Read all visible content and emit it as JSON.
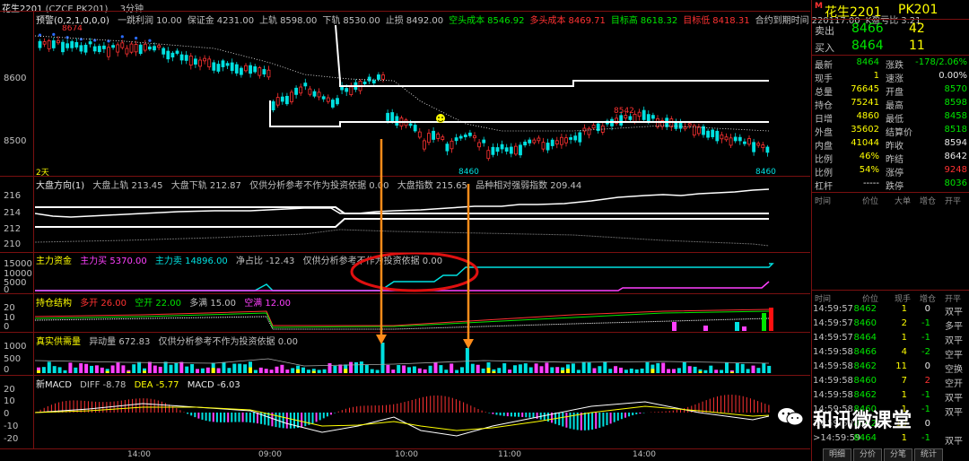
{
  "top_bar": {
    "symbol_label": "花生2201",
    "code_label": "(CZCE PK201)",
    "period_label": "3分钟"
  },
  "main_panel": {
    "indicator_name": "预警(0,2,1,0,0,0)",
    "stats": [
      {
        "label": "一跳利润",
        "value": "10.00",
        "color": "#c0c0c0"
      },
      {
        "label": "保证金",
        "value": "4231.00",
        "color": "#c0c0c0"
      },
      {
        "label": "上轨",
        "value": "8598.00",
        "color": "#c0c0c0"
      },
      {
        "label": "下轨",
        "value": "8530.00",
        "color": "#c0c0c0"
      },
      {
        "label": "止损",
        "value": "8492.00",
        "color": "#c0c0c0"
      },
      {
        "label": "空头成本",
        "value": "8546.92",
        "color": "#00e600"
      },
      {
        "label": "多头成本",
        "value": "8469.71",
        "color": "#ff3232"
      },
      {
        "label": "目标高",
        "value": "8618.32",
        "color": "#00e600"
      },
      {
        "label": "目标低",
        "value": "8418.31",
        "color": "#ff3232"
      },
      {
        "label": "合约到期时间",
        "value": "220117.00",
        "color": "#c0c0c0"
      },
      {
        "label": "K盈亏比",
        "value": "3.21",
        "color": "#c0c0c0"
      }
    ],
    "y_labels": [
      "8600",
      "8500"
    ],
    "high_mark": "8674",
    "mid_mark": "8542",
    "low_mark_1": "8460",
    "low_mark_2": "8460",
    "days_label": "2天"
  },
  "market_panel": {
    "title": "大盘方向(1)",
    "items": [
      "大盘上轨 213.45",
      "大盘下轨 212.87",
      "仅供分析参考不作为投资依据 0.00",
      "大盘指数 215.65",
      "品种相对强弱指数 209.44"
    ],
    "y_labels": [
      "216",
      "214",
      "212",
      "210"
    ]
  },
  "capital_panel": {
    "title": "主力资金",
    "buy_label": "主力买 5370.00",
    "sell_label": "主力卖 14896.00",
    "net_label": "净占比 -12.43",
    "note": "仅供分析参考不作为投资依据 0.00",
    "y_labels": [
      "15000",
      "10000",
      "5000",
      "0"
    ]
  },
  "position_panel": {
    "title": "持仓结构",
    "items": [
      {
        "text": "多开 26.00",
        "color": "#ff3232"
      },
      {
        "text": "空开 22.00",
        "color": "#00e600"
      },
      {
        "text": "多满 15.00",
        "color": "#c0c0c0"
      },
      {
        "text": "空满 12.00",
        "color": "#ff40ff"
      }
    ],
    "y_labels": [
      "20",
      "10",
      "0"
    ]
  },
  "volume_panel": {
    "title": "真实供需量",
    "abnormal_label": "异动量 672.83",
    "note": "仅供分析参考不作为投资依据 0.00",
    "y_labels": [
      "1000",
      "500",
      "0"
    ]
  },
  "macd_panel": {
    "title": "新MACD",
    "diff": "DIFF -8.78",
    "dea": "DEA -5.77",
    "macd": "MACD -6.03",
    "y_labels": [
      "20",
      "10",
      "0",
      "-10",
      "-20"
    ]
  },
  "time_axis": [
    "14:00",
    "09:00",
    "10:00",
    "11:00",
    "14:00"
  ],
  "quote": {
    "m_badge": "M",
    "name": "花生2201",
    "code": "PK201",
    "sell_label": "卖出",
    "sell_price": "8466",
    "sell_vol": "42",
    "buy_label": "买入",
    "buy_price": "8464",
    "buy_vol": "11",
    "rows": [
      {
        "l1": "最新",
        "v1": "8464",
        "c1": "#00e600",
        "l2": "涨跌",
        "v2": "-178/2.06%",
        "c2": "#00e600"
      },
      {
        "l1": "现手",
        "v1": "1",
        "c1": "#ffff00",
        "l2": "速涨",
        "v2": "0.00%",
        "c2": "#e8e8e8"
      },
      {
        "l1": "总量",
        "v1": "76645",
        "c1": "#ffff00",
        "l2": "开盘",
        "v2": "8570",
        "c2": "#00e600"
      },
      {
        "l1": "持仓",
        "v1": "75241",
        "c1": "#ffff00",
        "l2": "最高",
        "v2": "8598",
        "c2": "#00e600"
      },
      {
        "l1": "日增",
        "v1": "4860",
        "c1": "#ffff00",
        "l2": "最低",
        "v2": "8458",
        "c2": "#00e600"
      },
      {
        "l1": "外盘",
        "v1": "35602",
        "c1": "#ffff00",
        "l2": "结算价",
        "v2": "8518",
        "c2": "#00e600"
      },
      {
        "l1": "内盘",
        "v1": "41044",
        "c1": "#ffff00",
        "l2": "昨收",
        "v2": "8594",
        "c2": "#e8e8e8"
      },
      {
        "l1": "比例",
        "v1": "46%",
        "c1": "#ffff00",
        "l2": "昨结",
        "v2": "8642",
        "c2": "#e8e8e8"
      },
      {
        "l1": "比例",
        "v1": "54%",
        "c1": "#ffff00",
        "l2": "涨停",
        "v2": "9248",
        "c2": "#ff3232"
      },
      {
        "l1": "杠杆",
        "v1": "-----",
        "c1": "#e8e8e8",
        "l2": "跌停",
        "v2": "8036",
        "c2": "#00e600"
      }
    ],
    "big_headers": [
      "时间",
      "价位",
      "大单",
      "增仓",
      "开平"
    ],
    "tick_headers": [
      "时间",
      "价位",
      "现手",
      "增仓",
      "开平"
    ],
    "ticks": [
      {
        "t": "14:59:57",
        "p": "8462",
        "v": "1",
        "d": "0",
        "o": "双平",
        "pc": "#00e600",
        "dc": "#e8e8e8"
      },
      {
        "t": "14:59:57",
        "p": "8460",
        "v": "2",
        "d": "-1",
        "o": "多平",
        "pc": "#00e600",
        "dc": "#00e600"
      },
      {
        "t": "14:59:57",
        "p": "8464",
        "v": "1",
        "d": "-1",
        "o": "双平",
        "pc": "#00e600",
        "dc": "#00e600"
      },
      {
        "t": "14:59:58",
        "p": "8466",
        "v": "4",
        "d": "-2",
        "o": "空平",
        "pc": "#00e600",
        "dc": "#00e600"
      },
      {
        "t": "14:59:58",
        "p": "8462",
        "v": "11",
        "d": "0",
        "o": "空换",
        "pc": "#00e600",
        "dc": "#e8e8e8"
      },
      {
        "t": "14:59:58",
        "p": "8460",
        "v": "7",
        "d": "2",
        "o": "空开",
        "pc": "#00e600",
        "dc": "#ff3232"
      },
      {
        "t": "14:59:58",
        "p": "8462",
        "v": "1",
        "d": "-1",
        "o": "双平",
        "pc": "#00e600",
        "dc": "#00e600"
      },
      {
        "t": "14:59:58",
        "p": "8460",
        "v": "1",
        "d": "-1",
        "o": "双平",
        "pc": "#00e600",
        "dc": "#00e600"
      },
      {
        "t": "14:59:59",
        "p": "8462",
        "v": "10",
        "d": "0",
        "o": "",
        "pc": "#00e600",
        "dc": "#e8e8e8"
      },
      {
        "t": ">14:59:59",
        "p": "8464",
        "v": "1",
        "d": "-1",
        "o": "双平",
        "pc": "#00e600",
        "dc": "#00e600"
      }
    ],
    "tabs": [
      "明细",
      "分价",
      "分笔",
      "统计"
    ]
  },
  "watermark": "和讯微课堂"
}
